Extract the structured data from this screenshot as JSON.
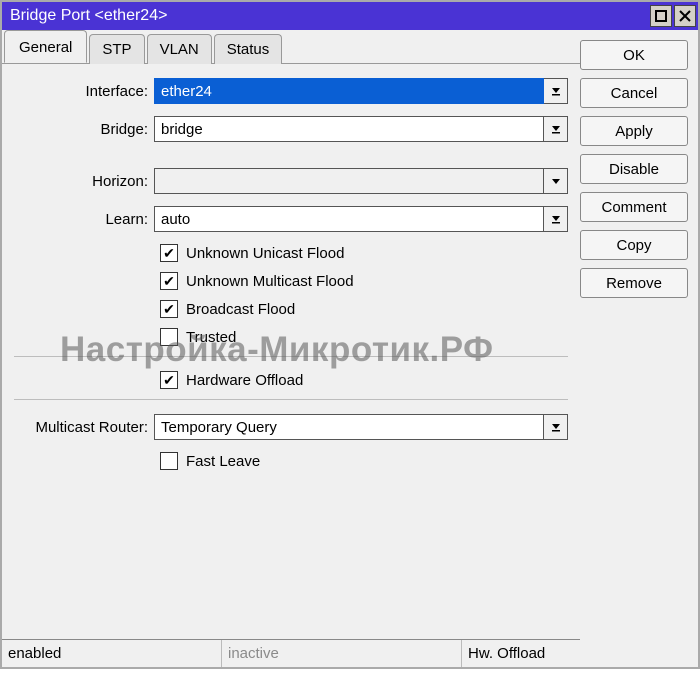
{
  "window": {
    "title": "Bridge Port <ether24>"
  },
  "tabs": {
    "general": "General",
    "stp": "STP",
    "vlan": "VLAN",
    "status": "Status"
  },
  "labels": {
    "interface": "Interface:",
    "bridge": "Bridge:",
    "horizon": "Horizon:",
    "learn": "Learn:",
    "mrouter": "Multicast Router:"
  },
  "values": {
    "interface": "ether24",
    "bridge": "bridge",
    "horizon": "",
    "learn": "auto",
    "mrouter": "Temporary Query"
  },
  "checks": {
    "uuf": "Unknown Unicast Flood",
    "umf": "Unknown Multicast Flood",
    "bf": "Broadcast Flood",
    "trusted": "Trusted",
    "hwo": "Hardware Offload",
    "fl": "Fast Leave"
  },
  "buttons": {
    "ok": "OK",
    "cancel": "Cancel",
    "apply": "Apply",
    "disable": "Disable",
    "comment": "Comment",
    "copy": "Copy",
    "remove": "Remove"
  },
  "status": {
    "s1": "enabled",
    "s2": "inactive",
    "s3": "Hw. Offload"
  },
  "watermark": "Настройка-Микротик.РФ"
}
